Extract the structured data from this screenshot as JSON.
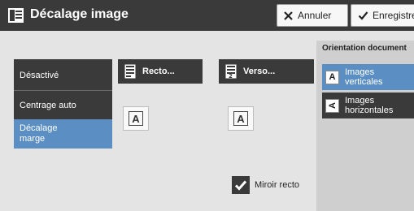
{
  "title": "Décalage image",
  "toolbar": {
    "cancel_label": "Annuler",
    "save_label": "Enregistrer"
  },
  "modes": [
    {
      "label": "Désactivé",
      "selected": false
    },
    {
      "label": "Centrage auto",
      "selected": false
    },
    {
      "label": "Décalage\nmarge",
      "selected": true
    }
  ],
  "sides": {
    "recto_label": "Recto...",
    "verso_label": "Verso..."
  },
  "preview_letter": "A",
  "mirror": {
    "label": "Miroir recto",
    "checked": true
  },
  "orientation": {
    "title": "Orientation document",
    "options": [
      {
        "label": "Images\nverticales",
        "selected": true
      },
      {
        "label": "Images\nhorizontales",
        "selected": false
      }
    ]
  },
  "colors": {
    "dark": "#3a3a3a",
    "accent": "#5b8fc3",
    "background": "#e4e4e4"
  }
}
